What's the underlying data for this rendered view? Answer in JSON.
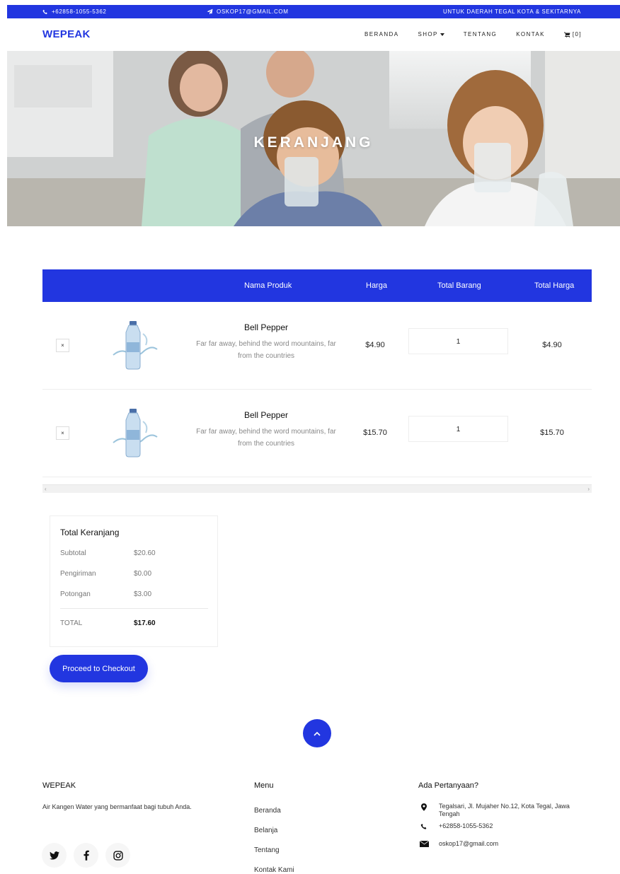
{
  "topbar": {
    "phone": "+62858-1055-5362",
    "email": "OSKOP17@GMAIL.COM",
    "region": "UNTUK DAERAH TEGAL KOTA & SEKITARNYA"
  },
  "brand": "WEPEAK",
  "nav": {
    "items": [
      "BERANDA",
      "SHOP",
      "TENTANG",
      "KONTAK"
    ],
    "cart": "[0]"
  },
  "hero": {
    "title": "KERANJANG"
  },
  "cart": {
    "headers": [
      "Nama Produk",
      "Harga",
      "Total Barang",
      "Total Harga"
    ],
    "rows": [
      {
        "remove": "×",
        "name": "Bell Pepper",
        "desc": "Far far away, behind the word mountains, far from the countries",
        "price": "$4.90",
        "qty": "1",
        "total": "$4.90"
      },
      {
        "remove": "×",
        "name": "Bell Pepper",
        "desc": "Far far away, behind the word mountains, far from the countries",
        "price": "$15.70",
        "qty": "1",
        "total": "$15.70"
      }
    ]
  },
  "summary": {
    "title": "Total Keranjang",
    "subtotal_label": "Subtotal",
    "subtotal": "$20.60",
    "shipping_label": "Pengiriman",
    "shipping": "$0.00",
    "discount_label": "Potongan",
    "discount": "$3.00",
    "total_label": "TOTAL",
    "total": "$17.60"
  },
  "checkout_label": "Proceed to Checkout",
  "footer": {
    "brand": "WEPEAK",
    "desc": "Air Kangen Water yang bermanfaat bagi tubuh Anda.",
    "menu_title": "Menu",
    "menu": [
      "Beranda",
      "Belanja",
      "Tentang",
      "Kontak Kami"
    ],
    "contact_title": "Ada Pertanyaan?",
    "address": "Tegalsari, Jl. Mujaher No.12, Kota Tegal, Jawa Tengah",
    "phone": "+62858-1055-5362",
    "email": "oskop17@gmail.com"
  },
  "colors": {
    "accent": "#2236e0"
  },
  "icons": [
    "phone-icon",
    "paper-plane-icon",
    "cart-icon",
    "chevron-up-icon",
    "twitter-icon",
    "facebook-icon",
    "instagram-icon",
    "map-marker-icon",
    "envelope-icon"
  ]
}
